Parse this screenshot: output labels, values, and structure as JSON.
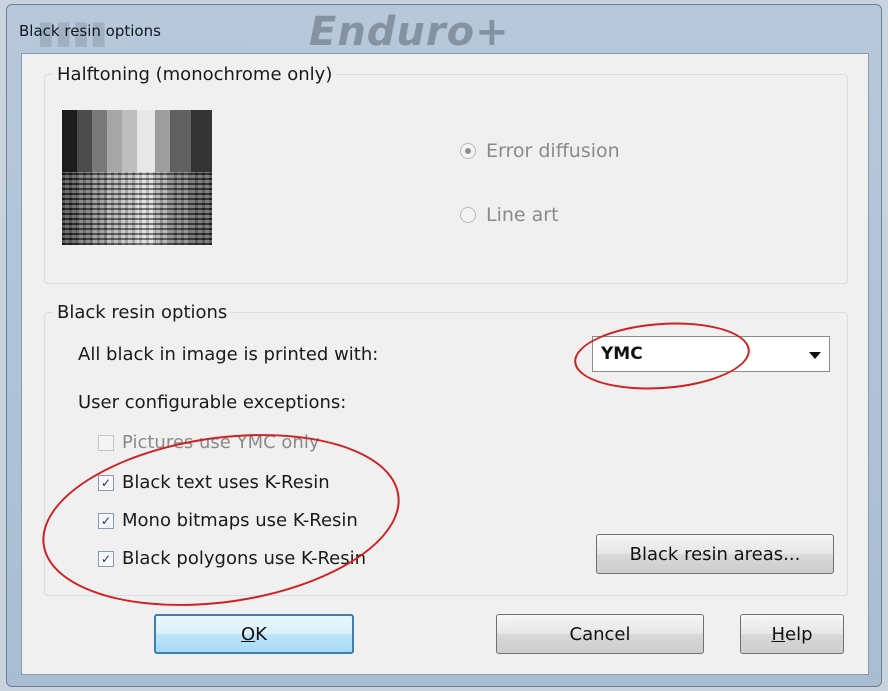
{
  "window": {
    "title": "Black resin options",
    "brand_text": "Enduro+"
  },
  "halftoning": {
    "legend": "Halftoning (monochrome only)",
    "options": [
      {
        "label": "Error diffusion",
        "selected": true,
        "enabled": false
      },
      {
        "label": "Line art",
        "selected": false,
        "enabled": false
      }
    ]
  },
  "resin": {
    "legend": "Black resin options",
    "printed_with_label": "All black in image is printed with:",
    "printed_with_value": "YMC",
    "exceptions_label": "User configurable exceptions:",
    "checkboxes": [
      {
        "label": "Pictures use YMC only",
        "checked": false,
        "enabled": false
      },
      {
        "label": "Black text uses K-Resin",
        "checked": true,
        "enabled": true
      },
      {
        "label": "Mono bitmaps use K-Resin",
        "checked": true,
        "enabled": true
      },
      {
        "label": "Black polygons use K-Resin",
        "checked": true,
        "enabled": true
      }
    ],
    "areas_button": "Black resin areas..."
  },
  "buttons": {
    "ok_prefix": "",
    "ok_mnemonic": "O",
    "ok_rest": "K",
    "cancel": "Cancel",
    "help_mnemonic": "H",
    "help_rest": "elp"
  },
  "colors": {
    "annotation": "#d02020",
    "check": "#1d2f66"
  }
}
